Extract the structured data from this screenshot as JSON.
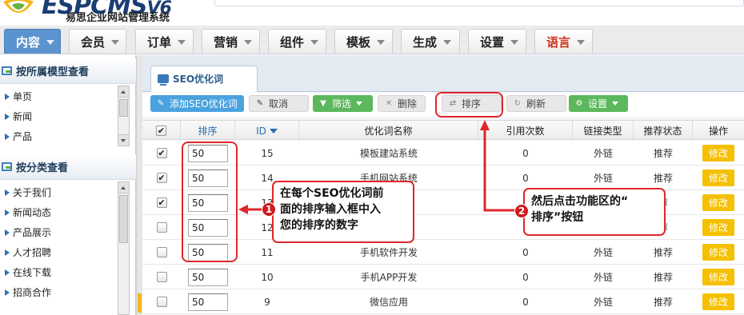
{
  "header": {
    "logo_text": "ESPCMS",
    "logo_version": "V6",
    "logo_subtitle": "易思企业网站管理系统"
  },
  "nav": {
    "items": [
      {
        "label": "内容",
        "active": true
      },
      {
        "label": "会员"
      },
      {
        "label": "订单"
      },
      {
        "label": "营销"
      },
      {
        "label": "组件"
      },
      {
        "label": "模板"
      },
      {
        "label": "生成"
      },
      {
        "label": "设置"
      },
      {
        "label": "语言",
        "accent": true
      }
    ]
  },
  "sidebar": {
    "section1": {
      "title": "按所属模型查看",
      "items": [
        "单页",
        "新闻",
        "产品"
      ]
    },
    "section2": {
      "title": "按分类查看",
      "items": [
        "关于我们",
        "新闻动态",
        "产品展示",
        "人才招聘",
        "在线下载",
        "招商合作"
      ]
    }
  },
  "tab": {
    "label": "SEO优化词"
  },
  "toolbar": {
    "add": "添加SEO优化词",
    "cancel": "取消",
    "filter": "筛选",
    "delete": "删除",
    "sort": "排序",
    "refresh": "刷新",
    "settings": "设置"
  },
  "table": {
    "headers": {
      "sort": "排序",
      "id": "ID",
      "name": "优化词名称",
      "refs": "引用次数",
      "link_type": "链接类型",
      "recommend": "推荐状态",
      "action": "操作"
    },
    "rows": [
      {
        "checked": true,
        "sort": "50",
        "id": "15",
        "name": "模板建站系统",
        "refs": "0",
        "link_type": "外链",
        "recommend": "推荐",
        "action": "修改"
      },
      {
        "checked": true,
        "sort": "50",
        "id": "14",
        "name": "手机网站系统",
        "refs": "0",
        "link_type": "外链",
        "recommend": "推荐",
        "action": "修改"
      },
      {
        "checked": true,
        "sort": "50",
        "id": "13",
        "name": "",
        "refs": "",
        "link_type": "",
        "recommend": "荐",
        "action": "修改"
      },
      {
        "checked": false,
        "sort": "50",
        "id": "12",
        "name": "",
        "refs": "",
        "link_type": "",
        "recommend": "荐",
        "action": "修改"
      },
      {
        "checked": false,
        "sort": "50",
        "id": "11",
        "name": "手机软件开发",
        "refs": "0",
        "link_type": "外链",
        "recommend": "推荐",
        "action": "修改"
      },
      {
        "checked": false,
        "sort": "50",
        "id": "10",
        "name": "手机APP开发",
        "refs": "0",
        "link_type": "外链",
        "recommend": "推荐",
        "action": "修改"
      },
      {
        "checked": false,
        "sort": "50",
        "id": "9",
        "name": "微信应用",
        "refs": "0",
        "link_type": "外链",
        "recommend": "推荐",
        "action": "修改"
      }
    ]
  },
  "annotations": {
    "callout1": {
      "number": "1",
      "lines": [
        "在每个SEO优化词前",
        "面的排序输入框中入",
        "您的排序的数字"
      ]
    },
    "callout2": {
      "number": "2",
      "lines": [
        "然后点击功能区的“",
        "排序”按钮"
      ]
    },
    "color": "#e0262a"
  },
  "colors": {
    "nav_active": "#5b93cf",
    "accent_red": "#d0311b",
    "edit_button": "#f5c000",
    "add_button": "#4aa3df",
    "green_button": "#5cb85c"
  }
}
